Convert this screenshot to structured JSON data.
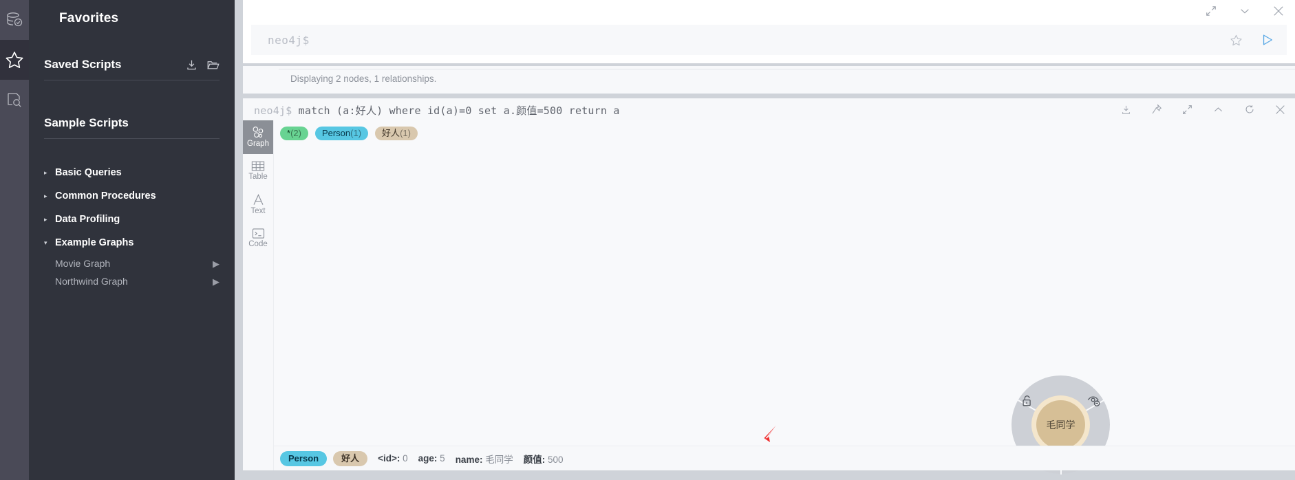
{
  "rail": {
    "items": [
      {
        "name": "database-icon",
        "label": "Database",
        "active": false
      },
      {
        "name": "star-icon",
        "label": "Favorites",
        "active": true
      },
      {
        "name": "document-search-icon",
        "label": "Documents",
        "active": false
      }
    ]
  },
  "drawer": {
    "title": "Favorites",
    "saved_scripts": {
      "title": "Saved Scripts",
      "import_icon": "download-icon",
      "folder_icon": "new-folder-icon"
    },
    "sample_scripts": {
      "title": "Sample Scripts",
      "groups": [
        {
          "label": "Basic Queries",
          "expanded": false,
          "caret": "▸"
        },
        {
          "label": "Common Procedures",
          "expanded": false,
          "caret": "▸"
        },
        {
          "label": "Data Profiling",
          "expanded": false,
          "caret": "▸"
        },
        {
          "label": "Example Graphs",
          "expanded": true,
          "caret": "▾"
        }
      ],
      "children": [
        {
          "label": "Movie Graph",
          "run": "▶"
        },
        {
          "label": "Northwind Graph",
          "run": "▶"
        }
      ]
    }
  },
  "editor": {
    "prompt_placeholder": "neo4j$",
    "window_icons": [
      "expand-icon",
      "chevron-down-icon",
      "close-icon"
    ],
    "favorite_icon": "star-outline-icon",
    "run_icon": "play-icon"
  },
  "info": {
    "text": "Displaying 2 nodes, 1 relationships."
  },
  "result": {
    "query_prefix": "neo4j$",
    "query": "match (a:好人) where id(a)=0 set a.颜值=500 return a",
    "toolbar_icons": [
      "download-icon",
      "pin-icon",
      "expand-icon",
      "chevron-up-icon",
      "rerun-icon",
      "close-icon"
    ],
    "view_tabs": [
      {
        "label": "Graph",
        "icon": "graph-icon",
        "active": true
      },
      {
        "label": "Table",
        "icon": "table-icon",
        "active": false
      },
      {
        "label": "Text",
        "icon": "text-icon",
        "active": false
      },
      {
        "label": "Code",
        "icon": "code-icon",
        "active": false
      }
    ],
    "chips": [
      {
        "label": "*",
        "count": "(2)",
        "color": "#68d392",
        "text": "#0b3d22"
      },
      {
        "label": "Person",
        "count": "(1)",
        "color": "#57c7e3",
        "text": "#07374a"
      },
      {
        "label": "好人",
        "count": "(1)",
        "color": "#d9c8ae",
        "text": "#3c3226"
      }
    ],
    "node": {
      "caption": "毛同学",
      "fill": "#d6bf96",
      "ring": "#f4e6cc",
      "halo": "#cdd0d6",
      "actions": [
        {
          "name": "unlock-icon",
          "position": "left"
        },
        {
          "name": "hide-node-icon",
          "position": "right"
        },
        {
          "name": "expand-node-icon",
          "position": "bottom"
        }
      ]
    },
    "inspector": {
      "labels": [
        {
          "label": "Person",
          "color": "#57c7e3",
          "text": "#07374a"
        },
        {
          "label": "好人",
          "color": "#d9c8ae",
          "text": "#3c3226"
        }
      ],
      "properties": [
        {
          "key": "<id>:",
          "value": "0"
        },
        {
          "key": "age:",
          "value": "5"
        },
        {
          "key": "name:",
          "value": "毛同学"
        },
        {
          "key": "颜值:",
          "value": "500"
        }
      ]
    }
  },
  "annotation": {
    "arrow_color": "#f03030",
    "arrow_icon": "red-arrow-annotation"
  }
}
